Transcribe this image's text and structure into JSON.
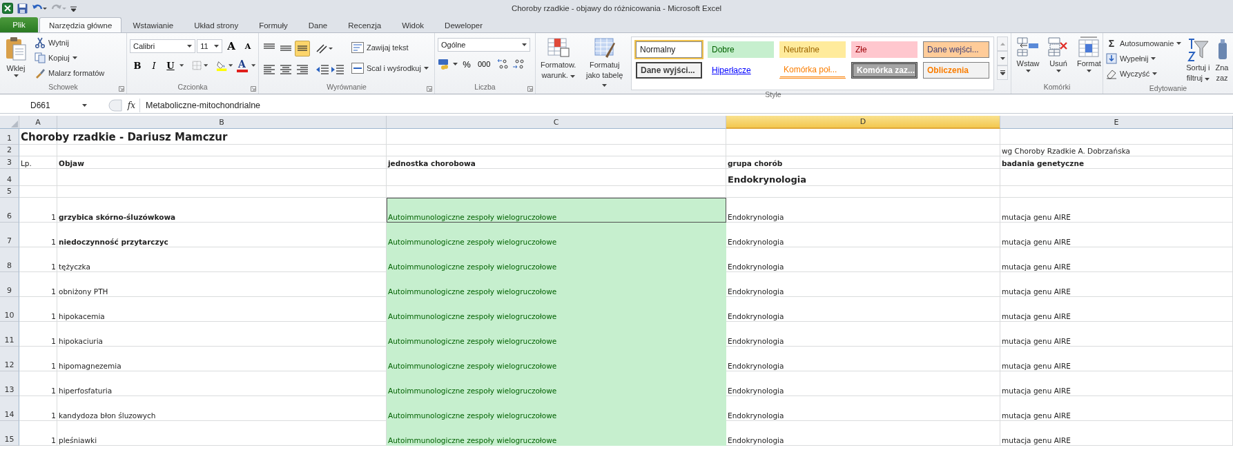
{
  "window": {
    "title": "Choroby rzadkie - objawy do różnicowania  -  Microsoft Excel"
  },
  "file_tab": "Plik",
  "tabs": [
    {
      "label": "Narzędzia główne",
      "selected": true
    },
    {
      "label": "Wstawianie",
      "selected": false
    },
    {
      "label": "Układ strony",
      "selected": false
    },
    {
      "label": "Formuły",
      "selected": false
    },
    {
      "label": "Dane",
      "selected": false
    },
    {
      "label": "Recenzja",
      "selected": false
    },
    {
      "label": "Widok",
      "selected": false
    },
    {
      "label": "Deweloper",
      "selected": false
    }
  ],
  "ribbon": {
    "clipboard": {
      "label": "Schowek",
      "paste": "Wklej",
      "cut": "Wytnij",
      "copy": "Kopiuj",
      "painter": "Malarz formatów"
    },
    "font": {
      "label": "Czcionka",
      "name": "Calibri",
      "size": "11",
      "grow": "A",
      "shrink": "A",
      "bold": "B",
      "italic": "I",
      "underline": "U",
      "color_letter": "A"
    },
    "alignment": {
      "label": "Wyrównanie",
      "wrap": "Zawijaj tekst",
      "merge": "Scal i wyśrodkuj",
      "bottom_align_selected": true
    },
    "number": {
      "label": "Liczba",
      "format": "Ogólne",
      "percent": "%",
      "thousands": "000"
    },
    "styles": {
      "label": "Style",
      "conditional": [
        "Formatow.",
        "warunk."
      ],
      "as_table": [
        "Formatuj",
        "jako tabelę"
      ],
      "gallery": [
        {
          "label": "Normalny",
          "kind": "normal",
          "selected": true
        },
        {
          "label": "Dobre",
          "kind": "good",
          "selected": false
        },
        {
          "label": "Neutralne",
          "kind": "neutral",
          "selected": false
        },
        {
          "label": "Złe",
          "kind": "bad",
          "selected": false
        },
        {
          "label": "Dane wejści...",
          "kind": "input",
          "selected": false
        },
        {
          "label": "Dane wyjści...",
          "kind": "output",
          "selected": false
        },
        {
          "label": "Hiperłącze",
          "kind": "hyperlink",
          "selected": false
        },
        {
          "label": "Komórka poł...",
          "kind": "linked",
          "selected": false
        },
        {
          "label": "Komórka zaz...",
          "kind": "check",
          "selected": false
        },
        {
          "label": "Obliczenia",
          "kind": "calculation",
          "selected": false
        }
      ]
    },
    "cells": {
      "label": "Komórki",
      "insert": "Wstaw",
      "delete": "Usuń",
      "format": "Format"
    },
    "editing": {
      "label": "Edytowanie",
      "sigma": "Σ",
      "autosum": "Autosumowanie",
      "fill": "Wypełnij",
      "clear": "Wyczyść",
      "sort": [
        "Sortuj i",
        "filtruj"
      ],
      "find": [
        "Zna",
        "zaz"
      ]
    }
  },
  "formula_bar": {
    "name_box": "D661",
    "fx": "fx",
    "value": "Metaboliczne-mitochondrialne"
  },
  "columns": [
    {
      "letter": "A",
      "selected": false
    },
    {
      "letter": "B",
      "selected": false
    },
    {
      "letter": "C",
      "selected": false
    },
    {
      "letter": "D",
      "selected": true
    },
    {
      "letter": "E",
      "selected": false
    }
  ],
  "rows": [
    {
      "number": "1",
      "kind": "title",
      "cells": {
        "A": {
          "text": "Choroby rzadkie - Dariusz Mamczur"
        }
      }
    },
    {
      "number": "2",
      "kind": "note",
      "cells": {
        "E": {
          "text": "wg Choroby Rzadkie A. Dobrzańska"
        }
      }
    },
    {
      "number": "3",
      "kind": "header",
      "cells": {
        "A": {
          "text": "Lp."
        },
        "B": {
          "text": "Objaw",
          "bold": true
        },
        "C": {
          "text": "jednostka chorobowa",
          "bold": true
        },
        "D": {
          "text": "grupa chorób",
          "bold": true
        },
        "E": {
          "text": "badania genetyczne",
          "bold": true
        }
      }
    },
    {
      "number": "4",
      "kind": "section",
      "cells": {
        "D": {
          "text": "Endokrynologia"
        }
      }
    },
    {
      "number": "5",
      "kind": "blank"
    },
    {
      "number": "6",
      "kind": "data",
      "cells": {
        "A": {
          "text": "1"
        },
        "B": {
          "text": "grzybica skórno-śluzówkowa",
          "bold": true
        },
        "C": {
          "text": "Autoimmunologiczne zespoły wielogruczołowe",
          "highlighted": true,
          "outlined": true
        },
        "D": {
          "text": "Endokrynologia"
        },
        "E": {
          "text": "mutacja genu AIRE"
        }
      }
    },
    {
      "number": "7",
      "kind": "data",
      "cells": {
        "A": {
          "text": "1"
        },
        "B": {
          "text": "niedoczynność przytarczyc",
          "bold": true
        },
        "C": {
          "text": "Autoimmunologiczne zespoły wielogruczołowe",
          "highlighted": true
        },
        "D": {
          "text": "Endokrynologia"
        },
        "E": {
          "text": "mutacja genu AIRE"
        }
      }
    },
    {
      "number": "8",
      "kind": "data",
      "cells": {
        "A": {
          "text": "1"
        },
        "B": {
          "text": "tężyczka"
        },
        "C": {
          "text": "Autoimmunologiczne zespoły wielogruczołowe",
          "highlighted": true
        },
        "D": {
          "text": "Endokrynologia"
        },
        "E": {
          "text": "mutacja genu AIRE"
        }
      }
    },
    {
      "number": "9",
      "kind": "data",
      "cells": {
        "A": {
          "text": "1"
        },
        "B": {
          "text": "obniżony PTH"
        },
        "C": {
          "text": "Autoimmunologiczne zespoły wielogruczołowe",
          "highlighted": true
        },
        "D": {
          "text": "Endokrynologia"
        },
        "E": {
          "text": "mutacja genu AIRE"
        }
      }
    },
    {
      "number": "10",
      "kind": "data",
      "cells": {
        "A": {
          "text": "1"
        },
        "B": {
          "text": "hipokacemia"
        },
        "C": {
          "text": "Autoimmunologiczne zespoły wielogruczołowe",
          "highlighted": true
        },
        "D": {
          "text": "Endokrynologia"
        },
        "E": {
          "text": "mutacja genu AIRE"
        }
      }
    },
    {
      "number": "11",
      "kind": "data",
      "cells": {
        "A": {
          "text": "1"
        },
        "B": {
          "text": "hipokaciuria"
        },
        "C": {
          "text": "Autoimmunologiczne zespoły wielogruczołowe",
          "highlighted": true
        },
        "D": {
          "text": "Endokrynologia"
        },
        "E": {
          "text": "mutacja genu AIRE"
        }
      }
    },
    {
      "number": "12",
      "kind": "data",
      "cells": {
        "A": {
          "text": "1"
        },
        "B": {
          "text": "hipomagnezemia"
        },
        "C": {
          "text": "Autoimmunologiczne zespoły wielogruczołowe",
          "highlighted": true
        },
        "D": {
          "text": "Endokrynologia"
        },
        "E": {
          "text": "mutacja genu AIRE"
        }
      }
    },
    {
      "number": "13",
      "kind": "data",
      "cells": {
        "A": {
          "text": "1"
        },
        "B": {
          "text": "hiperfosfaturia"
        },
        "C": {
          "text": "Autoimmunologiczne zespoły wielogruczołowe",
          "highlighted": true
        },
        "D": {
          "text": "Endokrynologia"
        },
        "E": {
          "text": "mutacja genu AIRE"
        }
      }
    },
    {
      "number": "14",
      "kind": "data",
      "cells": {
        "A": {
          "text": "1"
        },
        "B": {
          "text": "kandydoza błon śluzowych"
        },
        "C": {
          "text": "Autoimmunologiczne zespoły wielogruczołowe",
          "highlighted": true
        },
        "D": {
          "text": "Endokrynologia"
        },
        "E": {
          "text": "mutacja genu AIRE"
        }
      }
    },
    {
      "number": "15",
      "kind": "data",
      "cells": {
        "A": {
          "text": "1"
        },
        "B": {
          "text": "pleśniawki"
        },
        "C": {
          "text": "Autoimmunologiczne zespoły wielogruczołowe",
          "highlighted": true
        },
        "D": {
          "text": "Endokrynologia"
        },
        "E": {
          "text": "mutacja genu AIRE"
        }
      }
    }
  ]
}
